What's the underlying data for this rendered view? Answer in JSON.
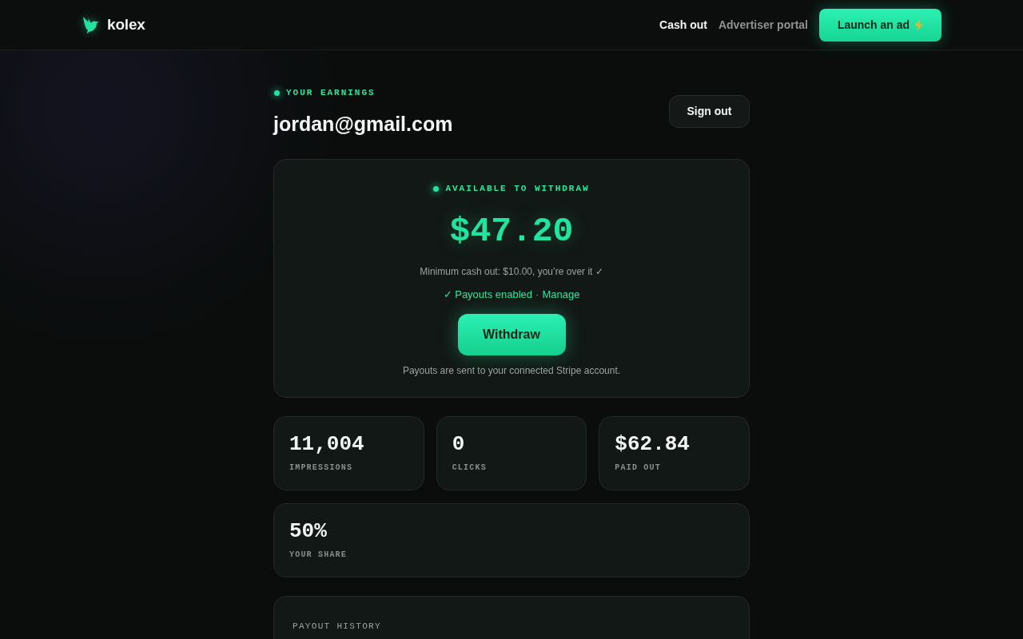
{
  "header": {
    "logo": {
      "name": "kolex"
    },
    "nav": [
      {
        "label": "Cash out",
        "selected": true
      },
      {
        "label": "Advertiser portal",
        "selected": false
      }
    ],
    "cta": {
      "label": "Launch an ad"
    }
  },
  "account": {
    "eyebrow": "YOUR EARNINGS",
    "email": "jordan@gmail.com",
    "sign_out": "Sign out"
  },
  "balance": {
    "eyebrow": "AVAILABLE TO WITHDRAW",
    "amount": "$47.20",
    "minimum_note": "Minimum cash out: $10.00, you’re over it ✓",
    "payout_status": "✓ Payouts enabled",
    "separator": "·",
    "manage_link": "Manage",
    "withdraw_button": "Withdraw",
    "footnote": "Payouts are sent to your connected Stripe account."
  },
  "stats": [
    {
      "value": "11,004",
      "label": "IMPRESSIONS"
    },
    {
      "value": "0",
      "label": "CLICKS"
    },
    {
      "value": "$62.84",
      "label": "PAID OUT"
    }
  ],
  "share": {
    "value": "50%",
    "label": "YOUR SHARE"
  },
  "payout_history": {
    "title": "PAYOUT HISTORY"
  }
}
